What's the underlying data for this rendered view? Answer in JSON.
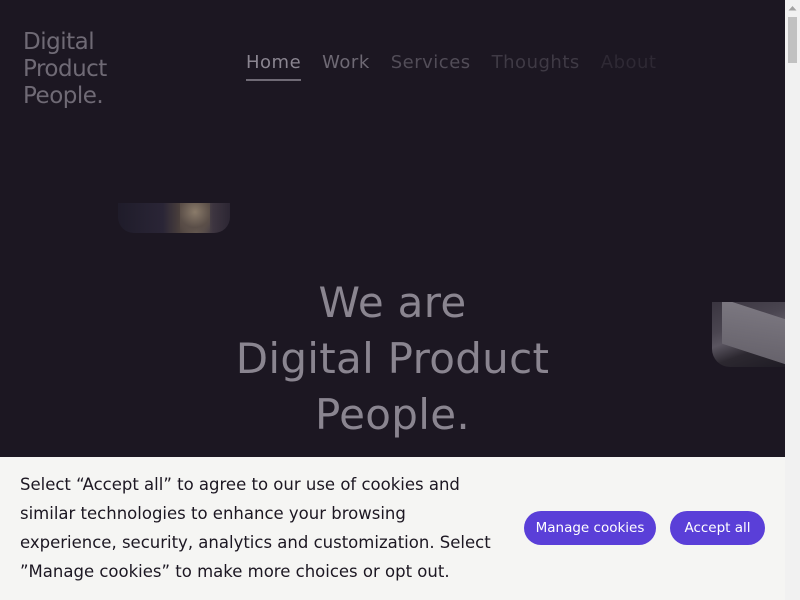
{
  "logo": {
    "lines": [
      "Digital",
      "Product",
      "People."
    ]
  },
  "nav": {
    "items": [
      {
        "label": "Home"
      },
      {
        "label": "Work"
      },
      {
        "label": "Services"
      },
      {
        "label": "Thoughts"
      },
      {
        "label": "About"
      }
    ],
    "active": "Home"
  },
  "hero": {
    "lines": [
      "We are",
      "Digital Product",
      "People."
    ]
  },
  "cookie_banner": {
    "text": "Select “Accept all” to agree to our use of cookies and similar technologies to enhance your browsing experience, security, analytics and customization. Select ”Manage cookies” to make more choices or opt out.",
    "manage_label": "Manage cookies",
    "accept_label": "Accept all"
  },
  "colors": {
    "background": "#1c1722",
    "accent": "#5a3fd8",
    "banner": "#f5f5f3"
  }
}
